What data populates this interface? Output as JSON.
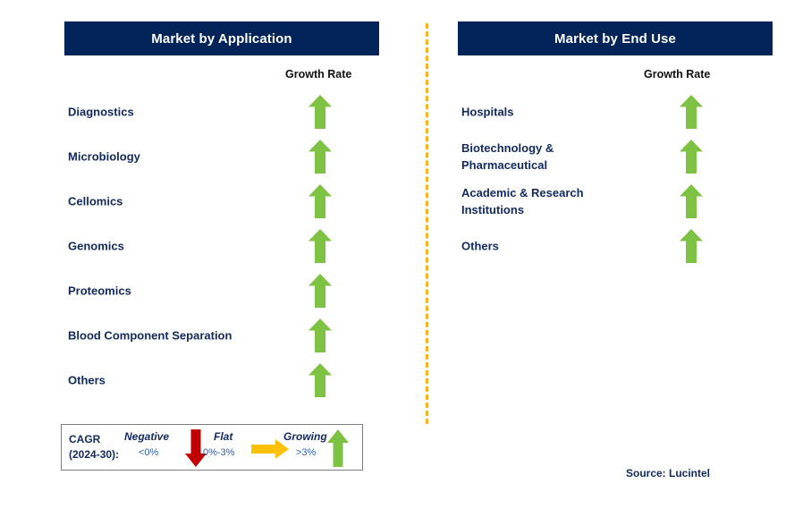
{
  "colors": {
    "header_bg": "#032459",
    "header_text": "#FFFFFF",
    "label_text": "#12295F",
    "arrow_up": "#7DC242",
    "arrow_down": "#C00000",
    "arrow_flat": "#FFC000",
    "divider": "#F6B221",
    "legend_border": "#7E7E7E",
    "legend_value_text": "#2E5FA3",
    "growth_rate_text": "#111111",
    "background": "#FFFFFF"
  },
  "panels": [
    {
      "id": "market-by-application",
      "title": "Market by Application",
      "growth_rate_label": "Growth Rate",
      "rows": [
        {
          "label": "Diagnostics",
          "trend": "growing",
          "icon": "arrow-up-icon"
        },
        {
          "label": "Microbiology",
          "trend": "growing",
          "icon": "arrow-up-icon"
        },
        {
          "label": "Cellomics",
          "trend": "growing",
          "icon": "arrow-up-icon"
        },
        {
          "label": "Genomics",
          "trend": "growing",
          "icon": "arrow-up-icon"
        },
        {
          "label": "Proteomics",
          "trend": "growing",
          "icon": "arrow-up-icon"
        },
        {
          "label": "Blood Component Separation",
          "trend": "growing",
          "icon": "arrow-up-icon"
        },
        {
          "label": "Others",
          "trend": "growing",
          "icon": "arrow-up-icon"
        }
      ]
    },
    {
      "id": "market-by-end-use",
      "title": "Market by End Use",
      "growth_rate_label": "Growth Rate",
      "rows": [
        {
          "label": "Hospitals",
          "trend": "growing",
          "icon": "arrow-up-icon"
        },
        {
          "label": "Biotechnology &\nPharmaceutical",
          "trend": "growing",
          "icon": "arrow-up-icon"
        },
        {
          "label": "Academic & Research\nInstitutions",
          "trend": "growing",
          "icon": "arrow-up-icon"
        },
        {
          "label": "Others",
          "trend": "growing",
          "icon": "arrow-up-icon"
        }
      ]
    }
  ],
  "legend": {
    "title": "CAGR\n(2024-30):",
    "entries": [
      {
        "name": "Negative",
        "value": "<0%",
        "icon": "arrow-down-icon"
      },
      {
        "name": "Flat",
        "value": "0%-3%",
        "icon": "arrow-right-icon"
      },
      {
        "name": "Growing",
        "value": ">3%",
        "icon": "arrow-up-icon"
      }
    ]
  },
  "source": "Source: Lucintel"
}
